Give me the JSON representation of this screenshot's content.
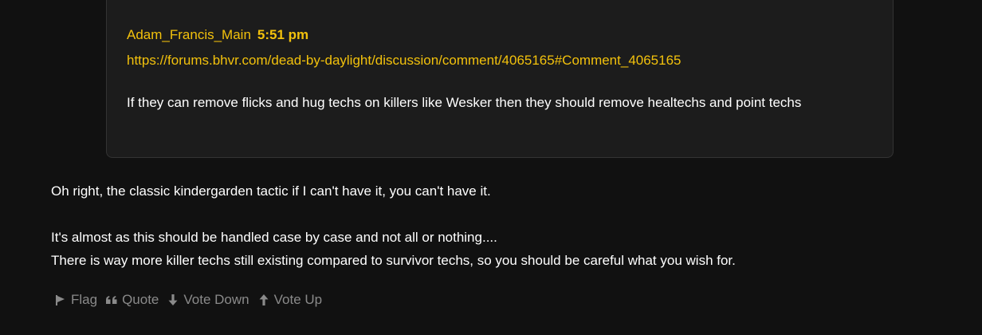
{
  "quote": {
    "author": "Adam_Francis_Main",
    "time": "5:51 pm",
    "link": "https://forums.bhvr.com/dead-by-daylight/discussion/comment/4065165#Comment_4065165",
    "text": "If they can remove flicks and hug techs on killers like Wesker then they should remove healtechs and point techs"
  },
  "post": {
    "line1": "Oh right, the classic kindergarden tactic if I can't have it, you can't have it.",
    "line2": "It's almost as this should be handled case by case and not all or nothing....",
    "line3": "There is way more killer techs still existing compared to survivor techs, so you should be careful what you wish for."
  },
  "actions": {
    "flag": "Flag",
    "quote": "Quote",
    "vote_down": "Vote Down",
    "vote_up": "Vote Up"
  },
  "icons": {
    "flag": "flag-icon",
    "quote": "quote-icon",
    "vote_down": "arrow-down-icon",
    "vote_up": "arrow-up-icon"
  },
  "colors": {
    "accent": "#f2c10c",
    "background": "#111111",
    "quote_background": "#1c1c1c",
    "muted": "#8a8a8a"
  }
}
